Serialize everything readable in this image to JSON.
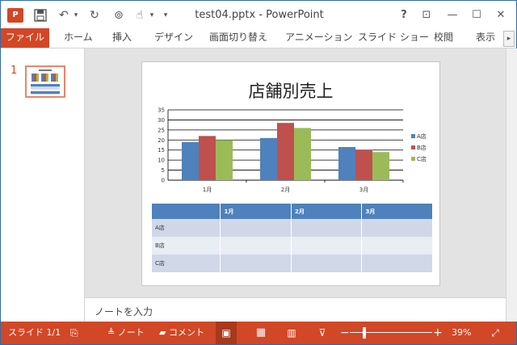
{
  "titlebar": {
    "app_icon": "P",
    "document_title": "test04.pptx - PowerPoint",
    "qat": {
      "save_icon": "save-icon",
      "undo_glyph": "↶",
      "dropdown_glyph": "▾",
      "redo_glyph": "↻",
      "present_glyph": "⊚",
      "touch_glyph": "☝",
      "customize_glyph": "▾"
    },
    "window_buttons": {
      "help": "?",
      "ribbon_options": "⊡",
      "minimize": "—",
      "maximize": "☐",
      "close": "✕"
    }
  },
  "ribbon": {
    "tabs": [
      "ファイル",
      "ホーム",
      "挿入",
      "デザイン",
      "画面切り替え",
      "アニメーション",
      "スライド ショー",
      "校閲",
      "表示"
    ],
    "scroll_glyph": "▸"
  },
  "thumbnails": {
    "items": [
      {
        "number": "1"
      }
    ]
  },
  "slide": {
    "title": "店舗別売上",
    "table": {
      "headers": [
        "",
        "1月",
        "2月",
        "3月"
      ],
      "rows": [
        [
          "A店",
          "",
          "",
          ""
        ],
        [
          "B店",
          "",
          "",
          ""
        ],
        [
          "C店",
          "",
          "",
          ""
        ]
      ]
    }
  },
  "chart_data": {
    "type": "bar",
    "categories": [
      "1月",
      "2月",
      "3月"
    ],
    "series": [
      {
        "name": "A店",
        "values": [
          19,
          21,
          16.5
        ],
        "color": "#4f81bd"
      },
      {
        "name": "B店",
        "values": [
          22,
          28.5,
          15
        ],
        "color": "#c0504d"
      },
      {
        "name": "C店",
        "values": [
          20,
          26,
          14
        ],
        "color": "#9bbb59"
      }
    ],
    "y_ticks": [
      0,
      5,
      10,
      15,
      20,
      25,
      30,
      35
    ],
    "ylim": [
      0,
      35
    ],
    "grid": true,
    "legend_position": "right"
  },
  "notes": {
    "placeholder": "ノートを入力"
  },
  "statusbar": {
    "slide_info": "スライド 1/1",
    "spell_glyph": "⎘",
    "notes_label": "ノート",
    "notes_glyph": "≜",
    "comments_label": "コメント",
    "comments_glyph": "▰",
    "normal_view_glyph": "▣",
    "sorter_view_glyph": "▦",
    "reading_view_glyph": "▥",
    "slideshow_glyph": "⊽",
    "zoom_out": "−",
    "zoom_in": "+",
    "zoom_level": "39%",
    "zoom_fraction": 0.18,
    "fit_glyph": "⤢"
  },
  "colors": {
    "accent": "#d24726",
    "table_header": "#4f81bd"
  }
}
